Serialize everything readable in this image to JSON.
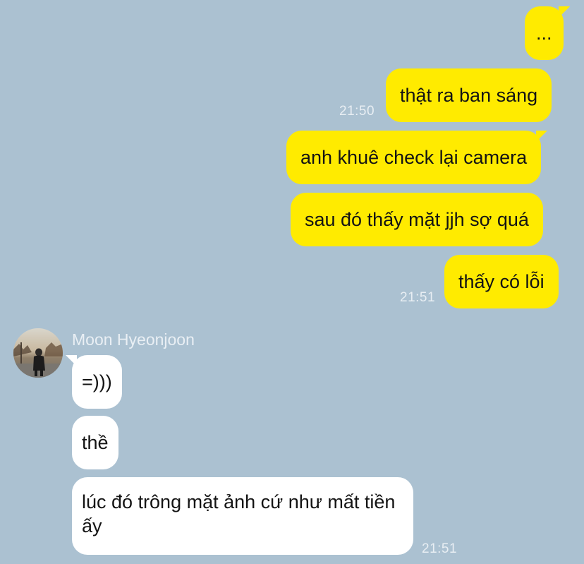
{
  "messages_out": [
    {
      "text": "...",
      "time": ""
    },
    {
      "text": "thật ra ban sáng",
      "time": "21:50"
    },
    {
      "text": "anh khuê check lại camera",
      "time": ""
    },
    {
      "text": "sau đó thấy mặt jjh sợ quá",
      "time": ""
    },
    {
      "text": "thấy có lỗi",
      "time": "21:51"
    }
  ],
  "incoming": {
    "sender_name": "Moon Hyeonjoon",
    "avatar_icon": "profile-photo-avatar",
    "messages": [
      {
        "text": "=)))",
        "time": ""
      },
      {
        "text": "thề",
        "time": ""
      },
      {
        "text": "lúc đó trông mặt ảnh cứ như mất tiền ấy",
        "time": "21:51"
      }
    ]
  },
  "colors": {
    "background": "#abc1d1",
    "outgoing_bubble": "#ffeb00",
    "incoming_bubble": "#ffffff",
    "timestamp": "#e8eef3"
  }
}
